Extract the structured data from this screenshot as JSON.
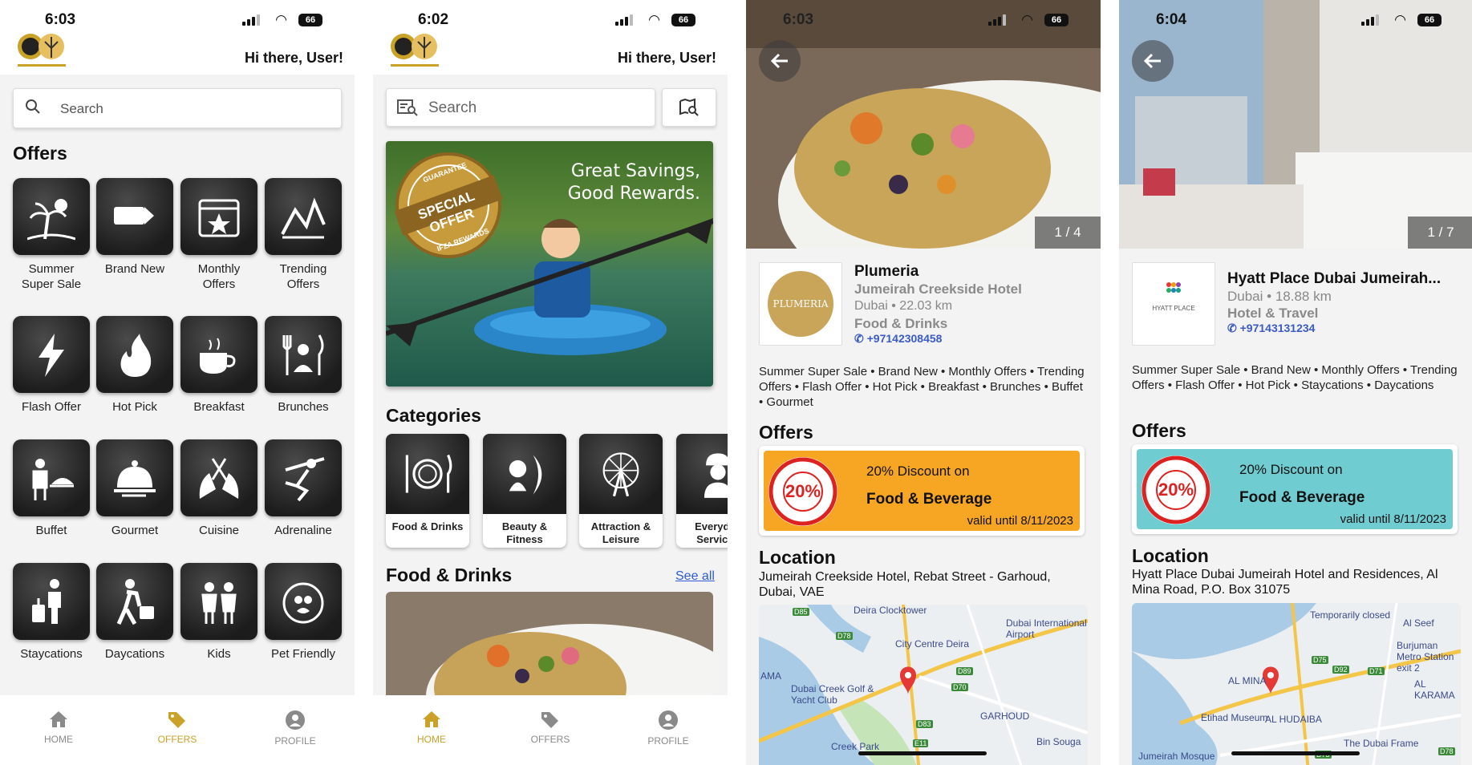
{
  "screens": {
    "offers": {
      "status": {
        "time": "6:03",
        "battery": "66"
      },
      "greeting": "Hi there, User!",
      "search_placeholder": "Search",
      "section_title": "Offers",
      "tiles": [
        {
          "label": "Summer Super Sale",
          "icon": "palm-sun-icon"
        },
        {
          "label": "Brand New",
          "icon": "new-tag-icon"
        },
        {
          "label": "Monthly Offers",
          "icon": "calendar-star-icon"
        },
        {
          "label": "Trending Offers",
          "icon": "trending-icon"
        },
        {
          "label": "Flash Offer",
          "icon": "lightning-icon"
        },
        {
          "label": "Hot Pick",
          "icon": "flame-icon"
        },
        {
          "label": "Breakfast",
          "icon": "coffee-croissant-icon"
        },
        {
          "label": "Brunches",
          "icon": "cutlery-person-icon"
        },
        {
          "label": "Buffet",
          "icon": "buffet-icon"
        },
        {
          "label": "Gourmet",
          "icon": "cloche-icon"
        },
        {
          "label": "Cuisine",
          "icon": "hands-cutlery-icon"
        },
        {
          "label": "Adrenaline",
          "icon": "skydiver-icon"
        },
        {
          "label": "Staycations",
          "icon": "traveler-luggage-icon"
        },
        {
          "label": "Daycations",
          "icon": "walking-bag-icon"
        },
        {
          "label": "Kids",
          "icon": "kids-icon"
        },
        {
          "label": "Pet Friendly",
          "icon": "pet-icon"
        }
      ]
    },
    "home": {
      "status": {
        "time": "6:02",
        "battery": "66"
      },
      "greeting": "Hi there, User!",
      "search_placeholder": "Search",
      "banner": {
        "headline1": "Great Savings,",
        "headline2": "Good Rewards.",
        "stamp_top": "GUARANTEE",
        "stamp_main": "SPECIAL OFFER",
        "stamp_bottom": "IFZA REWARDS"
      },
      "categories_title": "Categories",
      "categories": [
        {
          "label": "Food & Drinks",
          "icon": "plate-cutlery-icon"
        },
        {
          "label": "Beauty & Fitness",
          "icon": "beauty-icon"
        },
        {
          "label": "Attraction & Leisure",
          "icon": "ferris-wheel-icon"
        },
        {
          "label": "Everyday Services",
          "icon": "worker-icon"
        }
      ],
      "food_title": "Food & Drinks",
      "see_all": "See all"
    },
    "plumeria": {
      "status": {
        "time": "6:03",
        "battery": "66"
      },
      "counter": "1 / 4",
      "logo_text": "PLUMERIA",
      "name": "Plumeria",
      "venue": "Jumeirah Creekside Hotel",
      "city_distance": "Dubai • 22.03 km",
      "category": "Food & Drinks",
      "phone": "+97142308458",
      "tags": "Summer Super Sale • Brand New • Monthly Offers • Trending Offers • Flash Offer • Hot Pick • Breakfast • Brunches • Buffet • Gourmet",
      "offers_title": "Offers",
      "coupon": {
        "line1": "20% Discount on",
        "line2": "Food & Beverage",
        "valid": "valid until 8/11/2023",
        "badge": "20%",
        "color": "#f6a623"
      },
      "location_title": "Location",
      "address": "Jumeirah Creekside Hotel, Rebat Street - Garhoud, Dubai, VAE",
      "map_labels": [
        "Deira Clocktower",
        "Dubai International Airport",
        "City Centre Deira",
        "Dubai Creek Golf & Yacht Club",
        "GARHOUD",
        "Creek Park",
        "Bin Souga",
        "D85",
        "D78",
        "D89",
        "D70",
        "D83",
        "E11",
        "AMA"
      ]
    },
    "hyatt": {
      "status": {
        "time": "6:04",
        "battery": "66"
      },
      "counter": "1 / 7",
      "logo_text": "HYATT PLACE",
      "name": "Hyatt Place Dubai Jumeirah...",
      "city_distance": "Dubai • 18.88 km",
      "category": "Hotel & Travel",
      "phone": "+97143131234",
      "tags": "Summer Super Sale • Brand New • Monthly Offers • Trending Offers • Flash Offer • Hot Pick • Staycations • Daycations",
      "offers_title": "Offers",
      "coupon": {
        "line1": "20% Discount on",
        "line2": "Food & Beverage",
        "valid": "valid until 8/11/2023",
        "badge": "20%",
        "color": "#6fcdd2"
      },
      "location_title": "Location",
      "address": "Hyatt Place Dubai Jumeirah Hotel and Residences, Al Mina Road, P.O. Box 31075",
      "map_labels": [
        "Temporarily closed",
        "Al Seef",
        "Burjuman Metro Station exit 2",
        "AL MINA",
        "AL KARAMA",
        "Etihad Museum",
        "AL HUDAIBA",
        "The Dubai Frame",
        "Jumeirah Mosque",
        "D75",
        "D92",
        "D71",
        "D73",
        "D78"
      ]
    }
  },
  "nav": {
    "home": "HOME",
    "offers": "OFFERS",
    "profile": "PROFILE"
  },
  "colors": {
    "accent_gold": "#c9a227",
    "link_blue": "#2d5bd4"
  }
}
